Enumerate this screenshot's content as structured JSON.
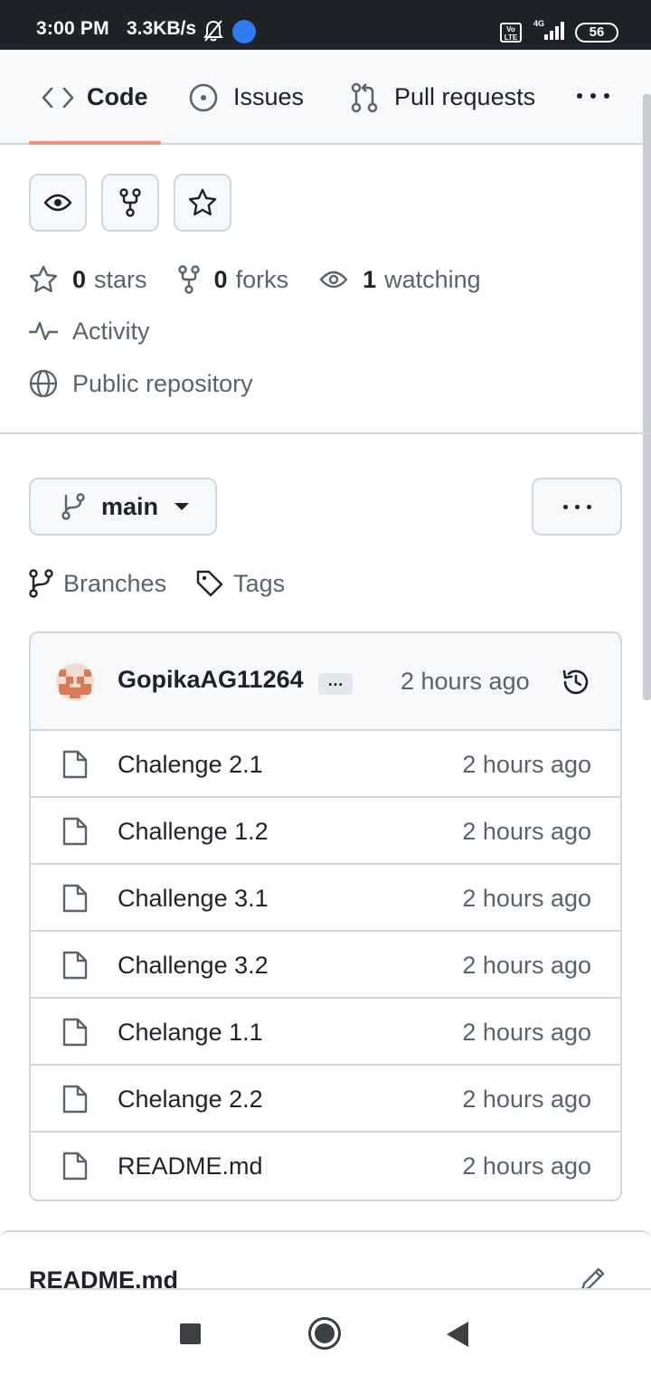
{
  "status_bar": {
    "time": "3:00 PM",
    "network_speed": "3.3KB/s",
    "volte_label": "Vo\nLTE",
    "network_type": "4G",
    "battery": "56"
  },
  "repo_nav": {
    "tabs": [
      {
        "label": "Code",
        "icon": "code-icon",
        "active": true
      },
      {
        "label": "Issues",
        "icon": "issue-opened-icon",
        "active": false
      },
      {
        "label": "Pull requests",
        "icon": "git-pull-request-icon",
        "active": false
      }
    ],
    "active_underline_color": "#fd8c73"
  },
  "stats": {
    "stars_count": "0",
    "stars_label": "stars",
    "forks_count": "0",
    "forks_label": "forks",
    "watching_count": "1",
    "watching_label": "watching"
  },
  "meta": {
    "activity_label": "Activity",
    "visibility_label": "Public repository"
  },
  "branch": {
    "current": "main",
    "branches_label": "Branches",
    "tags_label": "Tags"
  },
  "latest_commit": {
    "author": "GopikaAG11264",
    "ellipsis": "…",
    "time": "2 hours ago"
  },
  "files": [
    {
      "name": "Chalenge 2.1",
      "time": "2 hours ago"
    },
    {
      "name": "Challenge 1.2",
      "time": "2 hours ago"
    },
    {
      "name": "Challenge 3.1",
      "time": "2 hours ago"
    },
    {
      "name": "Challenge 3.2",
      "time": "2 hours ago"
    },
    {
      "name": "Chelange 1.1",
      "time": "2 hours ago"
    },
    {
      "name": "Chelange 2.2",
      "time": "2 hours ago"
    },
    {
      "name": "README.md",
      "time": "2 hours ago"
    }
  ],
  "readme": {
    "title": "README.md"
  }
}
